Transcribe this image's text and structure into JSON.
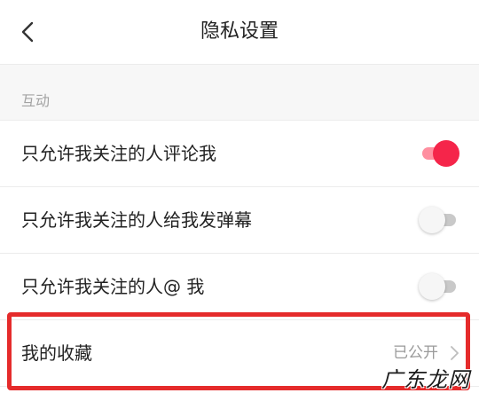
{
  "header": {
    "title": "隐私设置",
    "back_icon": "chevron-left-icon"
  },
  "section": {
    "label": "互动"
  },
  "rows": [
    {
      "label": "只允许我关注的人评论我",
      "toggle_on": true
    },
    {
      "label": "只允许我关注的人给我发弹幕",
      "toggle_on": false
    },
    {
      "label": "只允许我关注的人@ 我",
      "toggle_on": false
    }
  ],
  "favorites": {
    "label": "我的收藏",
    "value": "已公开",
    "icon": "chevron-right-icon"
  },
  "watermark": "广东龙网",
  "colors": {
    "accent": "#f5254a",
    "highlight_border": "#e52b2b",
    "secondary_text": "#9a9a9a"
  }
}
